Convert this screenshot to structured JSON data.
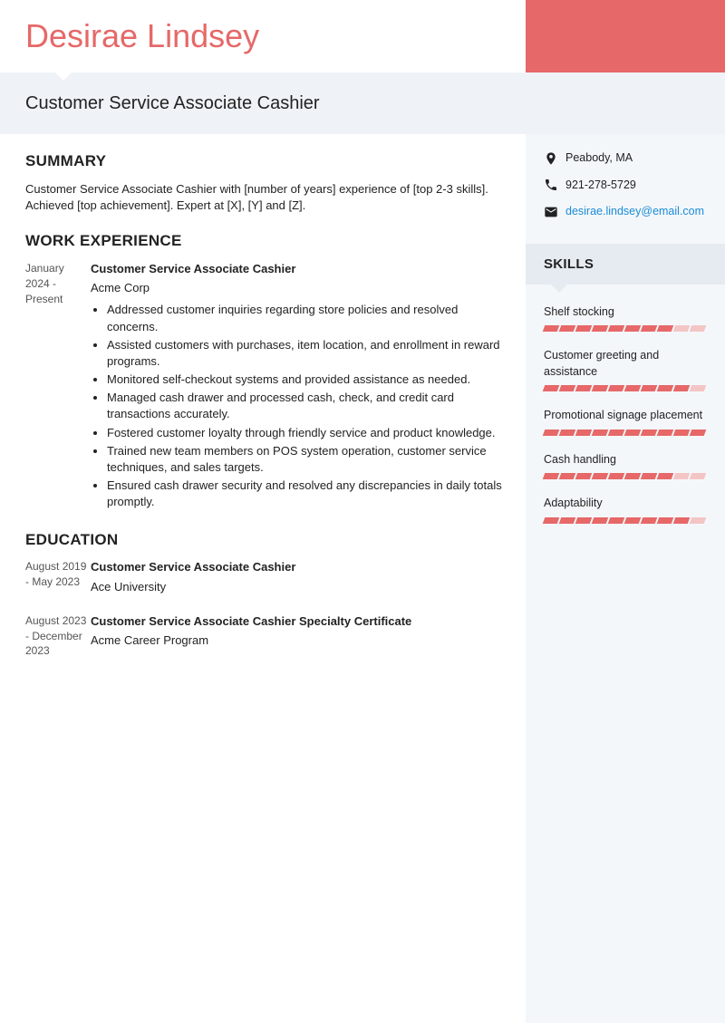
{
  "name": "Desirae Lindsey",
  "title": "Customer Service Associate Cashier",
  "sections": {
    "summary": "SUMMARY",
    "work": "WORK EXPERIENCE",
    "education": "EDUCATION",
    "skills": "SKILLS"
  },
  "summary_text": "Customer Service Associate Cashier with [number of years] experience of [top 2-3 skills]. Achieved [top achievement]. Expert at [X], [Y] and [Z].",
  "contact": {
    "location": "Peabody, MA",
    "phone": "921-278-5729",
    "email": "desirae.lindsey@email.com"
  },
  "work": [
    {
      "date": "January 2024 - Present",
      "title": "Customer Service Associate Cashier",
      "org": "Acme Corp",
      "bullets": [
        "Addressed customer inquiries regarding store policies and resolved concerns.",
        "Assisted customers with purchases, item location, and enrollment in reward programs.",
        "Monitored self-checkout systems and provided assistance as needed.",
        "Managed cash drawer and processed cash, check, and credit card transactions accurately.",
        "Fostered customer loyalty through friendly service and product knowledge.",
        "Trained new team members on POS system operation, customer service techniques, and sales targets.",
        "Ensured cash drawer security and resolved any discrepancies in daily totals promptly."
      ]
    }
  ],
  "education": [
    {
      "date": "August 2019 - May 2023",
      "title": "Customer Service Associate Cashier",
      "org": "Ace University"
    },
    {
      "date": "August 2023 - December 2023",
      "title": "Customer Service Associate Cashier Specialty Certificate",
      "org": "Acme Career Program"
    }
  ],
  "skills": [
    {
      "name": "Shelf stocking",
      "level": 8
    },
    {
      "name": "Customer greeting and assistance",
      "level": 9
    },
    {
      "name": "Promotional signage placement",
      "level": 10
    },
    {
      "name": "Cash handling",
      "level": 8
    },
    {
      "name": "Adaptability",
      "level": 9
    }
  ],
  "skill_max": 10
}
